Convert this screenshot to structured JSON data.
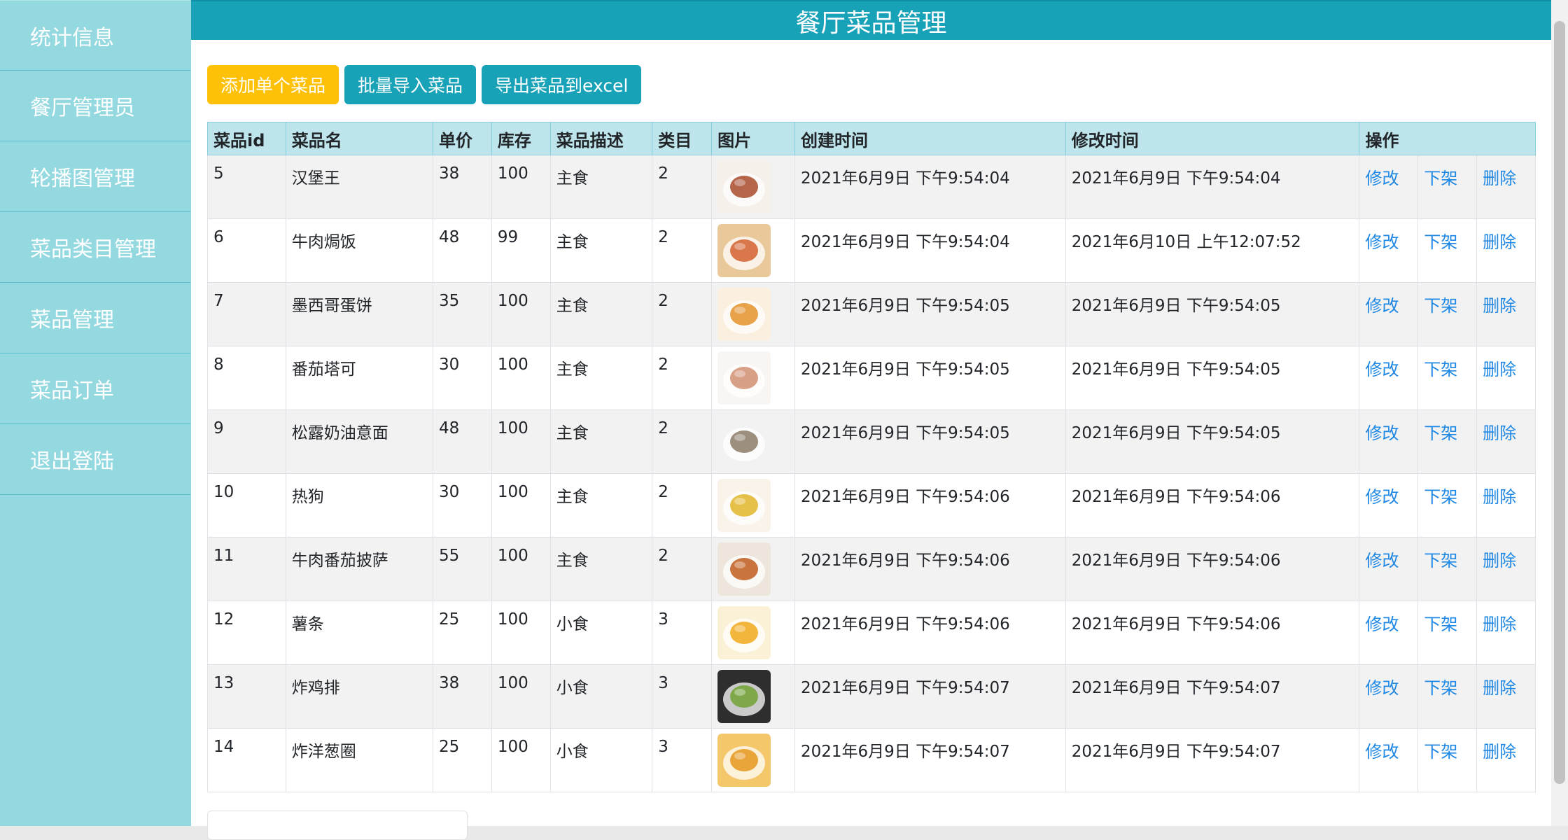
{
  "sidebar": {
    "items": [
      {
        "label": "统计信息"
      },
      {
        "label": "餐厅管理员"
      },
      {
        "label": "轮播图管理"
      },
      {
        "label": "菜品类目管理"
      },
      {
        "label": "菜品管理"
      },
      {
        "label": "菜品订单"
      },
      {
        "label": "退出登陆"
      }
    ]
  },
  "header": {
    "title": "餐厅菜品管理"
  },
  "toolbar": {
    "add_label": "添加单个菜品",
    "import_label": "批量导入菜品",
    "export_label": "导出菜品到excel"
  },
  "table": {
    "columns": [
      "菜品id",
      "菜品名",
      "单价",
      "库存",
      "菜品描述",
      "类目",
      "图片",
      "创建时间",
      "修改时间",
      "操作"
    ],
    "actions": {
      "edit": "修改",
      "offshelf": "下架",
      "delete": "删除"
    },
    "rows": [
      {
        "id": "5",
        "name": "汉堡王",
        "price": "38",
        "stock": "100",
        "desc": "主食",
        "cat": "2",
        "created": "2021年6月9日 下午9:54:04",
        "modified": "2021年6月9日 下午9:54:04",
        "img_color": "#b5654a",
        "img_bg": "#f6f0ea"
      },
      {
        "id": "6",
        "name": "牛肉焗饭",
        "price": "48",
        "stock": "99",
        "desc": "主食",
        "cat": "2",
        "created": "2021年6月9日 下午9:54:04",
        "modified": "2021年6月10日 上午12:07:52",
        "img_color": "#d9774a",
        "img_bg": "#e9c99a"
      },
      {
        "id": "7",
        "name": "墨西哥蛋饼",
        "price": "35",
        "stock": "100",
        "desc": "主食",
        "cat": "2",
        "created": "2021年6月9日 下午9:54:05",
        "modified": "2021年6月9日 下午9:54:05",
        "img_color": "#e8a24a",
        "img_bg": "#fbefe0"
      },
      {
        "id": "8",
        "name": "番茄塔可",
        "price": "30",
        "stock": "100",
        "desc": "主食",
        "cat": "2",
        "created": "2021年6月9日 下午9:54:05",
        "modified": "2021年6月9日 下午9:54:05",
        "img_color": "#d9a088",
        "img_bg": "#f9f5f2"
      },
      {
        "id": "9",
        "name": "松露奶油意面",
        "price": "48",
        "stock": "100",
        "desc": "主食",
        "cat": "2",
        "created": "2021年6月9日 下午9:54:05",
        "modified": "2021年6月9日 下午9:54:05",
        "img_color": "#9c8f7e",
        "img_bg": "#f2f2f2"
      },
      {
        "id": "10",
        "name": "热狗",
        "price": "30",
        "stock": "100",
        "desc": "主食",
        "cat": "2",
        "created": "2021年6月9日 下午9:54:06",
        "modified": "2021年6月9日 下午9:54:06",
        "img_color": "#e6c14a",
        "img_bg": "#f9f3ea"
      },
      {
        "id": "11",
        "name": "牛肉番茄披萨",
        "price": "55",
        "stock": "100",
        "desc": "主食",
        "cat": "2",
        "created": "2021年6月9日 下午9:54:06",
        "modified": "2021年6月9日 下午9:54:06",
        "img_color": "#c9743e",
        "img_bg": "#eee6dc"
      },
      {
        "id": "12",
        "name": "薯条",
        "price": "25",
        "stock": "100",
        "desc": "小食",
        "cat": "3",
        "created": "2021年6月9日 下午9:54:06",
        "modified": "2021年6月9日 下午9:54:06",
        "img_color": "#f2b63c",
        "img_bg": "#fbf1d6"
      },
      {
        "id": "13",
        "name": "炸鸡排",
        "price": "38",
        "stock": "100",
        "desc": "小食",
        "cat": "3",
        "created": "2021年6月9日 下午9:54:07",
        "modified": "2021年6月9日 下午9:54:07",
        "img_color": "#7fa84a",
        "img_bg": "#2e2e2e"
      },
      {
        "id": "14",
        "name": "炸洋葱圈",
        "price": "25",
        "stock": "100",
        "desc": "小食",
        "cat": "3",
        "created": "2021年6月9日 下午9:54:07",
        "modified": "2021年6月9日 下午9:54:07",
        "img_color": "#e9a53a",
        "img_bg": "#f4c86a"
      }
    ]
  },
  "colors": {
    "sidebar_bg": "#94d9e0",
    "header_bg": "#17a2b8",
    "warning": "#ffc107",
    "info": "#17a2b8",
    "link": "#1f88e5",
    "thead_bg": "#bee5eb"
  }
}
